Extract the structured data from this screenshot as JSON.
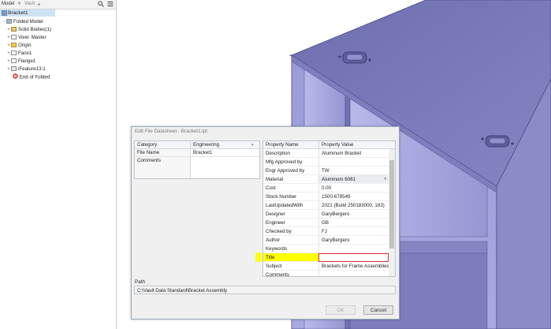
{
  "browser": {
    "tabs": [
      {
        "label": "Model"
      },
      {
        "label": "Vault"
      }
    ],
    "part_name": "Bracket1",
    "tree": [
      {
        "label": "Folded Model"
      },
      {
        "label": "Solid Bodies(1)"
      },
      {
        "label": "View: Master"
      },
      {
        "label": "Origin"
      },
      {
        "label": "Face1"
      },
      {
        "label": "Flange1"
      },
      {
        "label": "iFeature13:1"
      },
      {
        "label": "End of Folded"
      }
    ]
  },
  "dialog": {
    "title": "Edit File Datasheet - Bracket1.ipt",
    "left_grid": {
      "header": {
        "col1": "Category",
        "col2": "Engineering"
      },
      "rows": [
        {
          "key": "File Name",
          "value": "Bracket1"
        },
        {
          "key": "Comments",
          "value": ""
        }
      ]
    },
    "prop_grid": {
      "header": {
        "col1": "Property Name",
        "col2": "Property Value"
      },
      "rows": [
        {
          "name": "Description",
          "value": "Aluminum Bracket"
        },
        {
          "name": "Mfg Approved by",
          "value": ""
        },
        {
          "name": "Engr Approved by",
          "value": "TW"
        },
        {
          "name": "Material",
          "value": "Aluminum 6061"
        },
        {
          "name": "Cost",
          "value": "0.00"
        },
        {
          "name": "Stock Number",
          "value": "1500-678549"
        },
        {
          "name": "LastUpdatedWith",
          "value": "2021 (Build 250183000, 183)"
        },
        {
          "name": "Designer",
          "value": "GaryBergero"
        },
        {
          "name": "Engineer",
          "value": "GB"
        },
        {
          "name": "Checked by",
          "value": "FJ"
        },
        {
          "name": "Author",
          "value": "GaryBergero"
        },
        {
          "name": "Keywords",
          "value": ""
        },
        {
          "name": "Title",
          "value": ""
        },
        {
          "name": "Subject",
          "value": "Brackets for Frame Assemblies"
        },
        {
          "name": "Comments",
          "value": ""
        }
      ]
    },
    "path_label": "Path",
    "path_value": "C:\\Vault Data Standard\\Bracket Assembly",
    "ok_label": "OK",
    "cancel_label": "Cancel"
  },
  "colors": {
    "box_face": "#8f91cf",
    "box_top": "#7476b8",
    "highlight": "#ffff00",
    "error_border": "#e03030"
  }
}
